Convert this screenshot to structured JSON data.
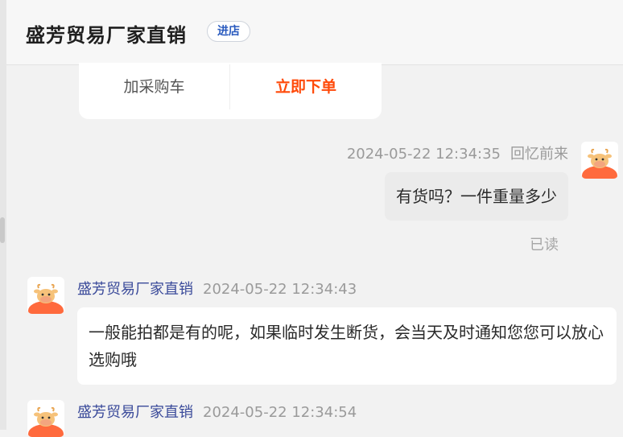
{
  "header": {
    "shop_name": "盛芳贸易厂家直销",
    "enter_label": "进店"
  },
  "product_card": {
    "cart_label": "加采购车",
    "order_label": "立即下单"
  },
  "messages": [
    {
      "side": "right",
      "timestamp": "2024-05-22 12:34:35",
      "sender": "回忆前来",
      "text": "有货吗？一件重量多少",
      "status": "已读",
      "avatar": "cow-avatar-icon"
    },
    {
      "side": "left",
      "sender": "盛芳贸易厂家直销",
      "timestamp": "2024-05-22 12:34:43",
      "text": "一般能拍都是有的呢，如果临时发生断货，会当天及时通知您您可以放心选购哦",
      "avatar": "cow-avatar-icon"
    },
    {
      "side": "left",
      "sender": "盛芳贸易厂家直销",
      "timestamp": "2024-05-22 12:34:54",
      "avatar": "cow-avatar-icon"
    }
  ],
  "colors": {
    "accent_orange": "#ff4a0a",
    "link_blue": "#2a5bbf",
    "sender_blue": "#3a4a9a",
    "avatar_orange": "#ff6a3d"
  }
}
